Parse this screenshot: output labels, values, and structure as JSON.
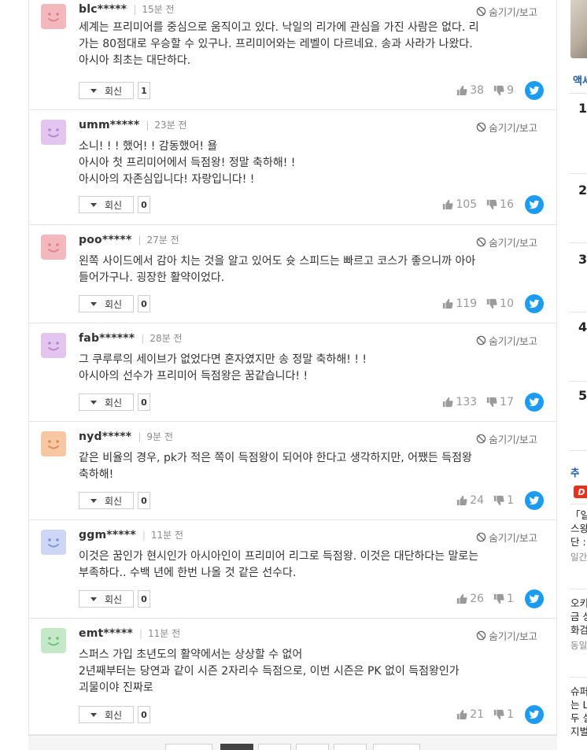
{
  "labels": {
    "reply": "회신",
    "hide_report": "숨기기/보고"
  },
  "comments": [
    {
      "user": "blc*****",
      "time": "15분 전",
      "avatar_color": "#f2b8bd",
      "avatar_face": "#e07f88",
      "lines": [
        "세계는 프리미어를 중심으로 움직이고 있다. 낙일의 리가에 관심을 가진 사람은 없다. 리",
        "가는 80점대로 우승할 수 있구나. 프리미어와는 레벨이 다르네요. 송과 사라가 나왔다.",
        "아시아 최초는 대단하다."
      ],
      "replies": "1",
      "likes": "38",
      "dislikes": "9"
    },
    {
      "user": "umm*****",
      "time": "23분 전",
      "avatar_color": "#e3c6ef",
      "avatar_face": "#b685d1",
      "lines": [
        "소니! ! ! 했어! ! 감동했어! 욜",
        "아시아 첫 프리미어에서 득점왕! 정말 축하해! !",
        "아시아의 자존심입니다! 자랑입니다! !"
      ],
      "replies": "0",
      "likes": "105",
      "dislikes": "16"
    },
    {
      "user": "poo*****",
      "time": "27분 전",
      "avatar_color": "#f2b8bd",
      "avatar_face": "#e07f88",
      "lines": [
        "왼쪽 사이드에서 감아 치는 것을 알고 있어도 슛 스피드는 빠르고 코스가 좋으니까 아아",
        "들어가구나. 굉장한 활약이었다."
      ],
      "replies": "0",
      "likes": "119",
      "dislikes": "10"
    },
    {
      "user": "fab******",
      "time": "28분 전",
      "avatar_color": "#e3c6ef",
      "avatar_face": "#b685d1",
      "lines": [
        "그 쿠루루의 세이브가 없었다면 혼자였지만 송 정말 축하해! ! !",
        "아시아의 선수가 프리미어 득점왕은 꿈같습니다! !"
      ],
      "replies": "0",
      "likes": "133",
      "dislikes": "17"
    },
    {
      "user": "nyd*****",
      "time": "9분 전",
      "avatar_color": "#f6c7a2",
      "avatar_face": "#d98c55",
      "lines": [
        "같은 비율의 경우, pk가 적은 쪽이 득점왕이 되어야 한다고 생각하지만, 어쨌든 득점왕",
        "축하해!"
      ],
      "replies": "0",
      "likes": "24",
      "dislikes": "1"
    },
    {
      "user": "ggm*****",
      "time": "11분 전",
      "avatar_color": "#cdd6f4",
      "avatar_face": "#7f93d6",
      "lines": [
        "이것은 꿈인가 현시인가 아시아인이 프리미어 리그로 득점왕. 이것은 대단하다는 말로는",
        "부족하다.. 수백 년에 한번 나올 것 같은 선수다."
      ],
      "replies": "0",
      "likes": "26",
      "dislikes": "1"
    },
    {
      "user": "emt*****",
      "time": "11분 전",
      "avatar_color": "#c4e8c8",
      "avatar_face": "#6fbd78",
      "lines": [
        "스퍼스 가입 초년도의 활약에서는 상상할 수 없어",
        "2년째부터는 당연과 같이 시즌 2자리수 득점으로, 이번 시즌은 PK 없이 득점왕인가",
        "괴물이야 진짜로"
      ],
      "replies": "0",
      "likes": "21",
      "dislikes": "1"
    }
  ],
  "sidebar": {
    "title": "액세",
    "ranks": [
      "1",
      "2",
      "3",
      "4",
      "5"
    ],
    "recommend_label": "추",
    "logo_text": "D",
    "articles": [
      {
        "lines": [
          "「일",
          "스왕",
          "단 :"
        ],
        "meta": "일간"
      },
      {
        "lines": [
          "오키",
          "금 상",
          "화검"
        ],
        "meta": "동일"
      },
      {
        "lines": [
          "슈퍼",
          "는 L",
          "두 실",
          "지벌"
        ],
        "meta": ""
      }
    ]
  }
}
